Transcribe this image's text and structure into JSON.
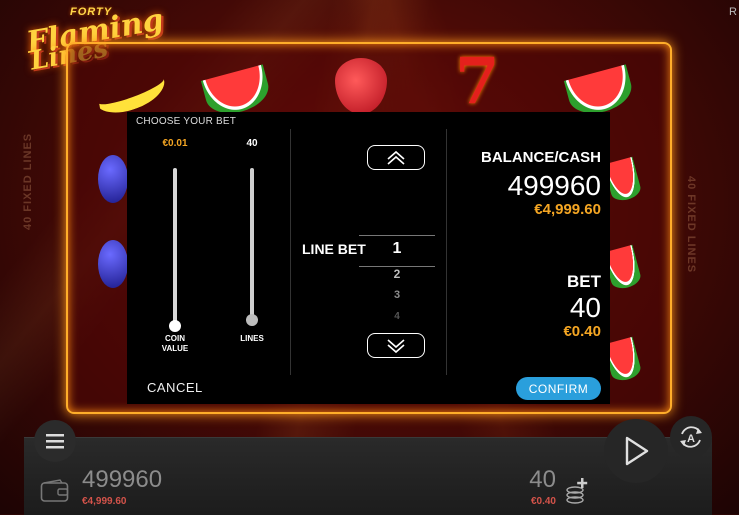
{
  "game": {
    "logo_top": "FORTY",
    "logo_line1": "Flaming",
    "logo_line2": "Lines",
    "side_label": "40 FIXED LINES",
    "corner_label": "R"
  },
  "dialog": {
    "title": "CHOOSE YOUR BET",
    "coin_slider": {
      "value": "€0.01",
      "caption_line1": "COIN",
      "caption_line2": "VALUE",
      "level": 0.0,
      "color": "#f5a623"
    },
    "lines_slider": {
      "value": "40",
      "caption": "LINES",
      "level": 0.0
    },
    "line_bet": {
      "label": "LINE BET",
      "options": [
        "1",
        "2",
        "3",
        "4"
      ],
      "selected": "1"
    },
    "balance": {
      "label": "BALANCE/CASH",
      "credits": "499960",
      "money": "€4,999.60"
    },
    "bet": {
      "label": "BET",
      "credits": "40",
      "money": "€0.40"
    },
    "cancel_label": "CANCEL",
    "confirm_label": "CONFIRM"
  },
  "bottom_bar": {
    "balance_credits": "499960",
    "balance_money": "€4,999.60",
    "bet_credits": "40",
    "bet_money": "€0.40"
  },
  "icons": [
    "menu-icon",
    "wallet-icon",
    "coins-stack-icon",
    "play-icon",
    "autoplay-icon",
    "chevron-up-icon",
    "chevron-down-icon"
  ],
  "colors": {
    "accent_gold": "#f5a623",
    "confirm_blue": "#2a9fdc",
    "frame_glow": "#ffae2a",
    "money_red": "#d4534a"
  }
}
